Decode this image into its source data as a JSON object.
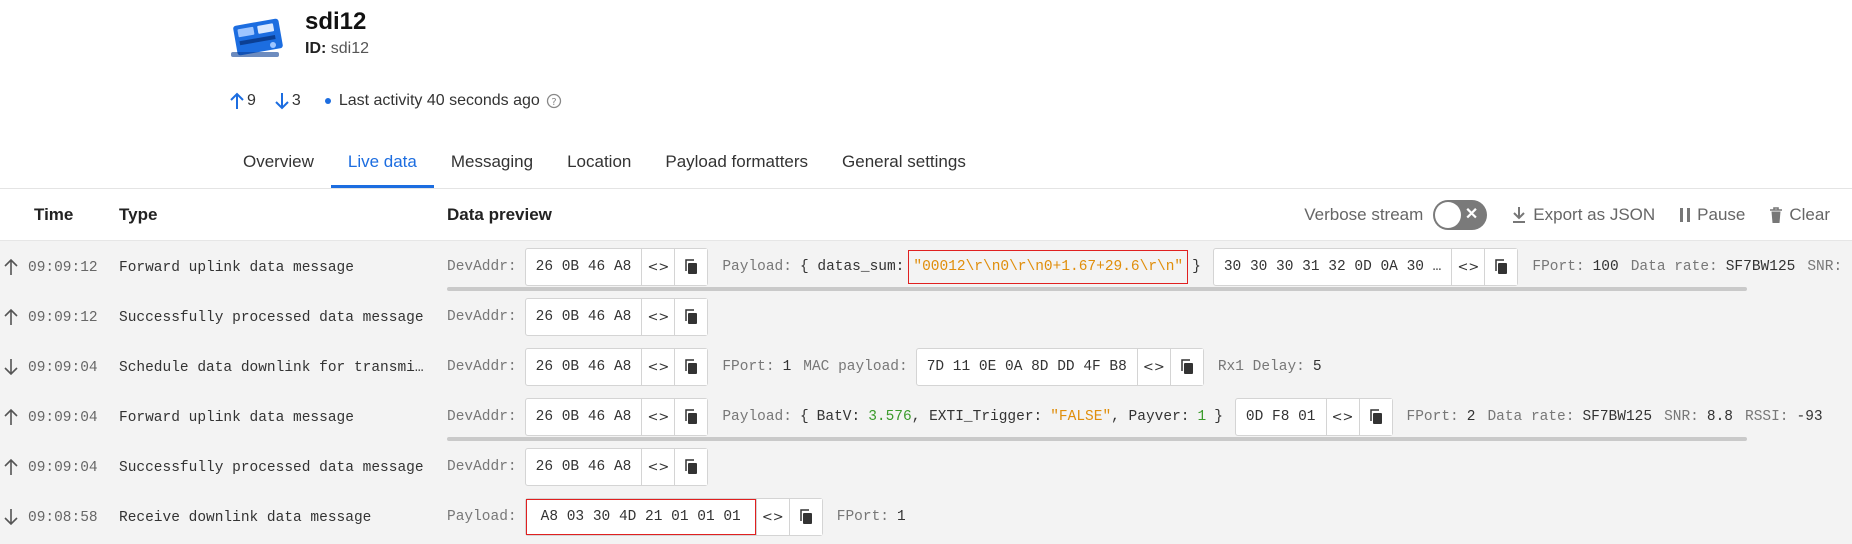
{
  "device": {
    "name": "sdi12",
    "id_label": "ID:",
    "id_value": "sdi12",
    "uplinks": "9",
    "downlinks": "3",
    "last_activity": "Last activity 40 seconds ago"
  },
  "tabs": [
    "Overview",
    "Live data",
    "Messaging",
    "Location",
    "Payload formatters",
    "General settings"
  ],
  "active_tab": "Live data",
  "table": {
    "col_time": "Time",
    "col_type": "Type",
    "col_preview": "Data preview",
    "verbose_label": "Verbose stream",
    "export_label": "Export as JSON",
    "pause_label": "Pause",
    "clear_label": "Clear"
  },
  "rows": [
    {
      "direction": "up",
      "time": "09:09:12",
      "type": "Forward uplink data message",
      "devaddr_label": "DevAddr:",
      "devaddr": "26 0B 46 A8",
      "payload_label": "Payload:",
      "payload_open": "{ datas_sum:",
      "payload_value": "\"00012\\r\\n0\\r\\n0+1.67+29.6\\r\\n\"",
      "payload_close": "}",
      "payload_bytes": "30 30 30 31 32 0D 0A 30 …",
      "fport_label": "FPort:",
      "fport": "100",
      "datarate_label": "Data rate:",
      "datarate": "SF7BW125",
      "snr_label": "SNR:"
    },
    {
      "direction": "up",
      "time": "09:09:12",
      "type": "Successfully processed data message",
      "devaddr_label": "DevAddr:",
      "devaddr": "26 0B 46 A8"
    },
    {
      "direction": "down",
      "time": "09:09:04",
      "type": "Schedule data downlink for transmission",
      "devaddr_label": "DevAddr:",
      "devaddr": "26 0B 46 A8",
      "fport_label": "FPort:",
      "fport": "1",
      "mac_label": "MAC payload:",
      "mac": "7D 11 0E 0A 8D DD 4F B8",
      "rx1_label": "Rx1 Delay:",
      "rx1": "5"
    },
    {
      "direction": "up",
      "time": "09:09:04",
      "type": "Forward uplink data message",
      "devaddr_label": "DevAddr:",
      "devaddr": "26 0B 46 A8",
      "payload_label": "Payload:",
      "payload_open": "{",
      "batv_key": "BatV:",
      "batv": "3.576",
      "exti_key": ", EXTI_Trigger:",
      "exti": "\"FALSE\"",
      "payver_key": ", Payver:",
      "payver": "1",
      "payload_close": "}",
      "payload_bytes": "0D F8 01",
      "fport_label": "FPort:",
      "fport": "2",
      "datarate_label": "Data rate:",
      "datarate": "SF7BW125",
      "snr_label": "SNR:",
      "snr": "8.8",
      "rssi_label": "RSSI:",
      "rssi": "-93"
    },
    {
      "direction": "up",
      "time": "09:09:04",
      "type": "Successfully processed data message",
      "devaddr_label": "DevAddr:",
      "devaddr": "26 0B 46 A8"
    },
    {
      "direction": "down",
      "time": "09:08:58",
      "type": "Receive downlink data message",
      "payload_label": "Payload:",
      "payload_bytes": "A8 03 30 4D 21 01 01 01",
      "fport_label": "FPort:",
      "fport": "1"
    }
  ],
  "colors": {
    "accent": "#1c6de0",
    "number": "#3a9a2b",
    "string": "#e08e0b",
    "highlight": "#e02020"
  }
}
